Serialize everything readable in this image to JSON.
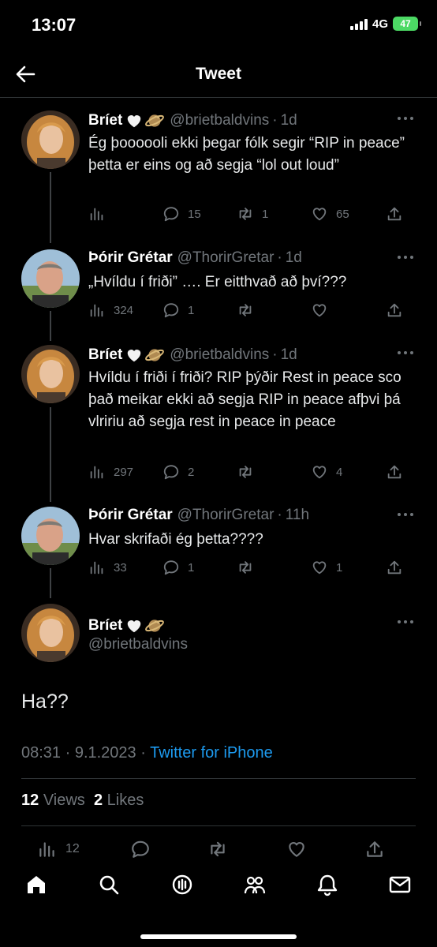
{
  "status_bar": {
    "time": "13:07",
    "network": "4G",
    "battery": "47"
  },
  "nav": {
    "title": "Tweet"
  },
  "tweets": [
    {
      "name": "Bríet",
      "handle": "@brietbaldvins",
      "time": "1d",
      "text": "Ég þoooooli ekki þegar fólk segir “RIP in peace” þetta er eins og að segja “lol out loud”",
      "replies": "15",
      "retweets": "1",
      "likes": "65",
      "views": ""
    },
    {
      "name": "Þórir Grétar",
      "handle": "@ThorirGretar",
      "time": "1d",
      "text": "„Hvíldu í friði” …. Er eitthvað að því???",
      "replies": "1",
      "retweets": "",
      "likes": "",
      "views": "324"
    },
    {
      "name": "Bríet",
      "handle": "@brietbaldvins",
      "time": "1d",
      "text": "Hvíldu í friði í friði? RIP þýðir Rest in peace sco það meikar ekki að segja RIP in peace afþvi þá vlririu að segja rest in peace in peace",
      "replies": "2",
      "retweets": "",
      "likes": "4",
      "views": "297"
    },
    {
      "name": "Þórir Grétar",
      "handle": "@ThorirGretar",
      "time": "11h",
      "text": "Hvar skrifaði ég þetta????",
      "replies": "1",
      "retweets": "",
      "likes": "1",
      "views": "33"
    }
  ],
  "main_tweet": {
    "name": "Bríet",
    "handle": "@brietbaldvins",
    "text": "Ha??",
    "time": "08:31 · 9.1.2023",
    "separator": " · ",
    "source": "Twitter for iPhone",
    "views_count": "12",
    "views_label": "Views",
    "likes_count": "2",
    "likes_label": "Likes",
    "analytics": "12"
  },
  "icons": {
    "accent": "#1d9bf0",
    "muted": "#71767b",
    "emoji": [
      "white-heart-icon",
      "ringed-planet-icon"
    ]
  }
}
